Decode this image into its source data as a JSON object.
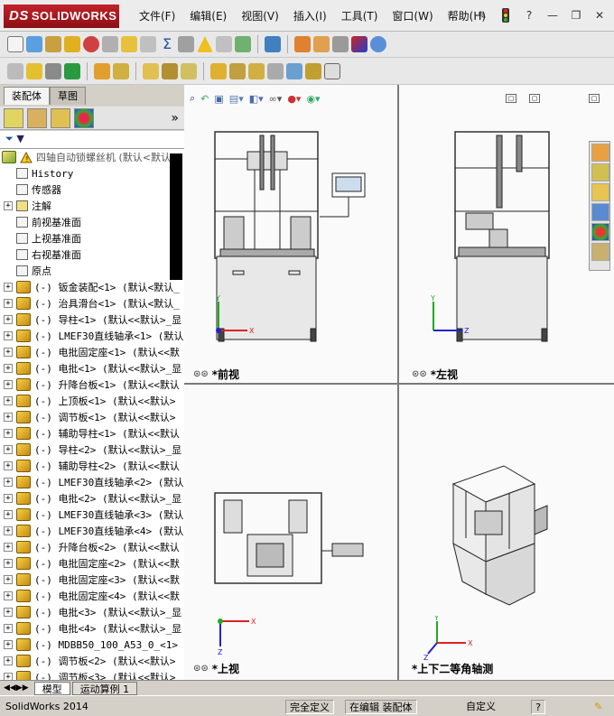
{
  "app": {
    "logo": "SOLIDWORKS",
    "logo_ds": "DS"
  },
  "menu": [
    "文件(F)",
    "编辑(E)",
    "视图(V)",
    "插入(I)",
    "工具(T)",
    "窗口(W)",
    "帮助(H)"
  ],
  "window_buttons": {
    "help": "?",
    "minimize": "—",
    "restore": "❐",
    "close": "✕"
  },
  "panel_tabs": {
    "assembly": "装配体",
    "sketch": "草图"
  },
  "panel_expand": "»",
  "filter_label": "▼",
  "tree": {
    "root": "四轴自动锁螺丝机  (默认<默认_",
    "items": [
      {
        "label": "History",
        "exp": false
      },
      {
        "label": "传感器",
        "exp": false
      },
      {
        "label": "注解",
        "exp": true
      },
      {
        "label": "前视基准面",
        "exp": false
      },
      {
        "label": "上视基准面",
        "exp": false
      },
      {
        "label": "右视基准面",
        "exp": false
      },
      {
        "label": "原点",
        "exp": false
      },
      {
        "label": "(-) 钣金装配<1> (默认<默认_",
        "exp": true
      },
      {
        "label": "(-) 治具滑台<1> (默认<默认_",
        "exp": true
      },
      {
        "label": "(-) 导柱<1> (默认<<默认>_显",
        "exp": true
      },
      {
        "label": "(-) LMEF30直线轴承<1> (默认",
        "exp": true
      },
      {
        "label": "(-) 电批固定座<1> (默认<<默",
        "exp": true
      },
      {
        "label": "(-) 电批<1> (默认<<默认>_显",
        "exp": true
      },
      {
        "label": "(-) 升降台板<1> (默认<<默认",
        "exp": true
      },
      {
        "label": "(-) 上顶板<1> (默认<<默认>",
        "exp": true
      },
      {
        "label": "(-) 调节板<1> (默认<<默认>",
        "exp": true
      },
      {
        "label": "(-) 辅助导柱<1> (默认<<默认",
        "exp": true
      },
      {
        "label": "(-) 导柱<2> (默认<<默认>_显",
        "exp": true
      },
      {
        "label": "(-) 辅助导柱<2> (默认<<默认",
        "exp": true
      },
      {
        "label": "(-) LMEF30直线轴承<2> (默认",
        "exp": true
      },
      {
        "label": "(-) 电批<2> (默认<<默认>_显",
        "exp": true
      },
      {
        "label": "(-) LMEF30直线轴承<3> (默认",
        "exp": true
      },
      {
        "label": "(-) LMEF30直线轴承<4> (默认",
        "exp": true
      },
      {
        "label": "(-) 升降台板<2> (默认<<默认",
        "exp": true
      },
      {
        "label": "(-) 电批固定座<2> (默认<<默",
        "exp": true
      },
      {
        "label": "(-) 电批固定座<3> (默认<<默",
        "exp": true
      },
      {
        "label": "(-) 电批固定座<4> (默认<<默",
        "exp": true
      },
      {
        "label": "(-) 电批<3> (默认<<默认>_显",
        "exp": true
      },
      {
        "label": "(-) 电批<4> (默认<<默认>_显",
        "exp": true
      },
      {
        "label": "(-) MDBB50_100_A53_0_<1> (",
        "exp": true
      },
      {
        "label": "(-) 调节板<2> (默认<<默认>",
        "exp": true
      },
      {
        "label": "(-) 调节板<3> (默认<<默认>",
        "exp": true
      }
    ]
  },
  "viewports": {
    "front": "*前视",
    "left": "*左视",
    "top": "*上视",
    "iso": "*上下二等角轴测"
  },
  "axes": {
    "x": "X",
    "y": "Y",
    "z": "Z"
  },
  "bottom_tabs": [
    "模型",
    "运动算例 1"
  ],
  "status": {
    "app": "SolidWorks 2014",
    "defined": "完全定义",
    "editing": "在编辑 装配体",
    "custom": "自定义",
    "help": "?"
  },
  "colors": {
    "logo_red": "#b01a22",
    "accent": "#0a246a"
  }
}
